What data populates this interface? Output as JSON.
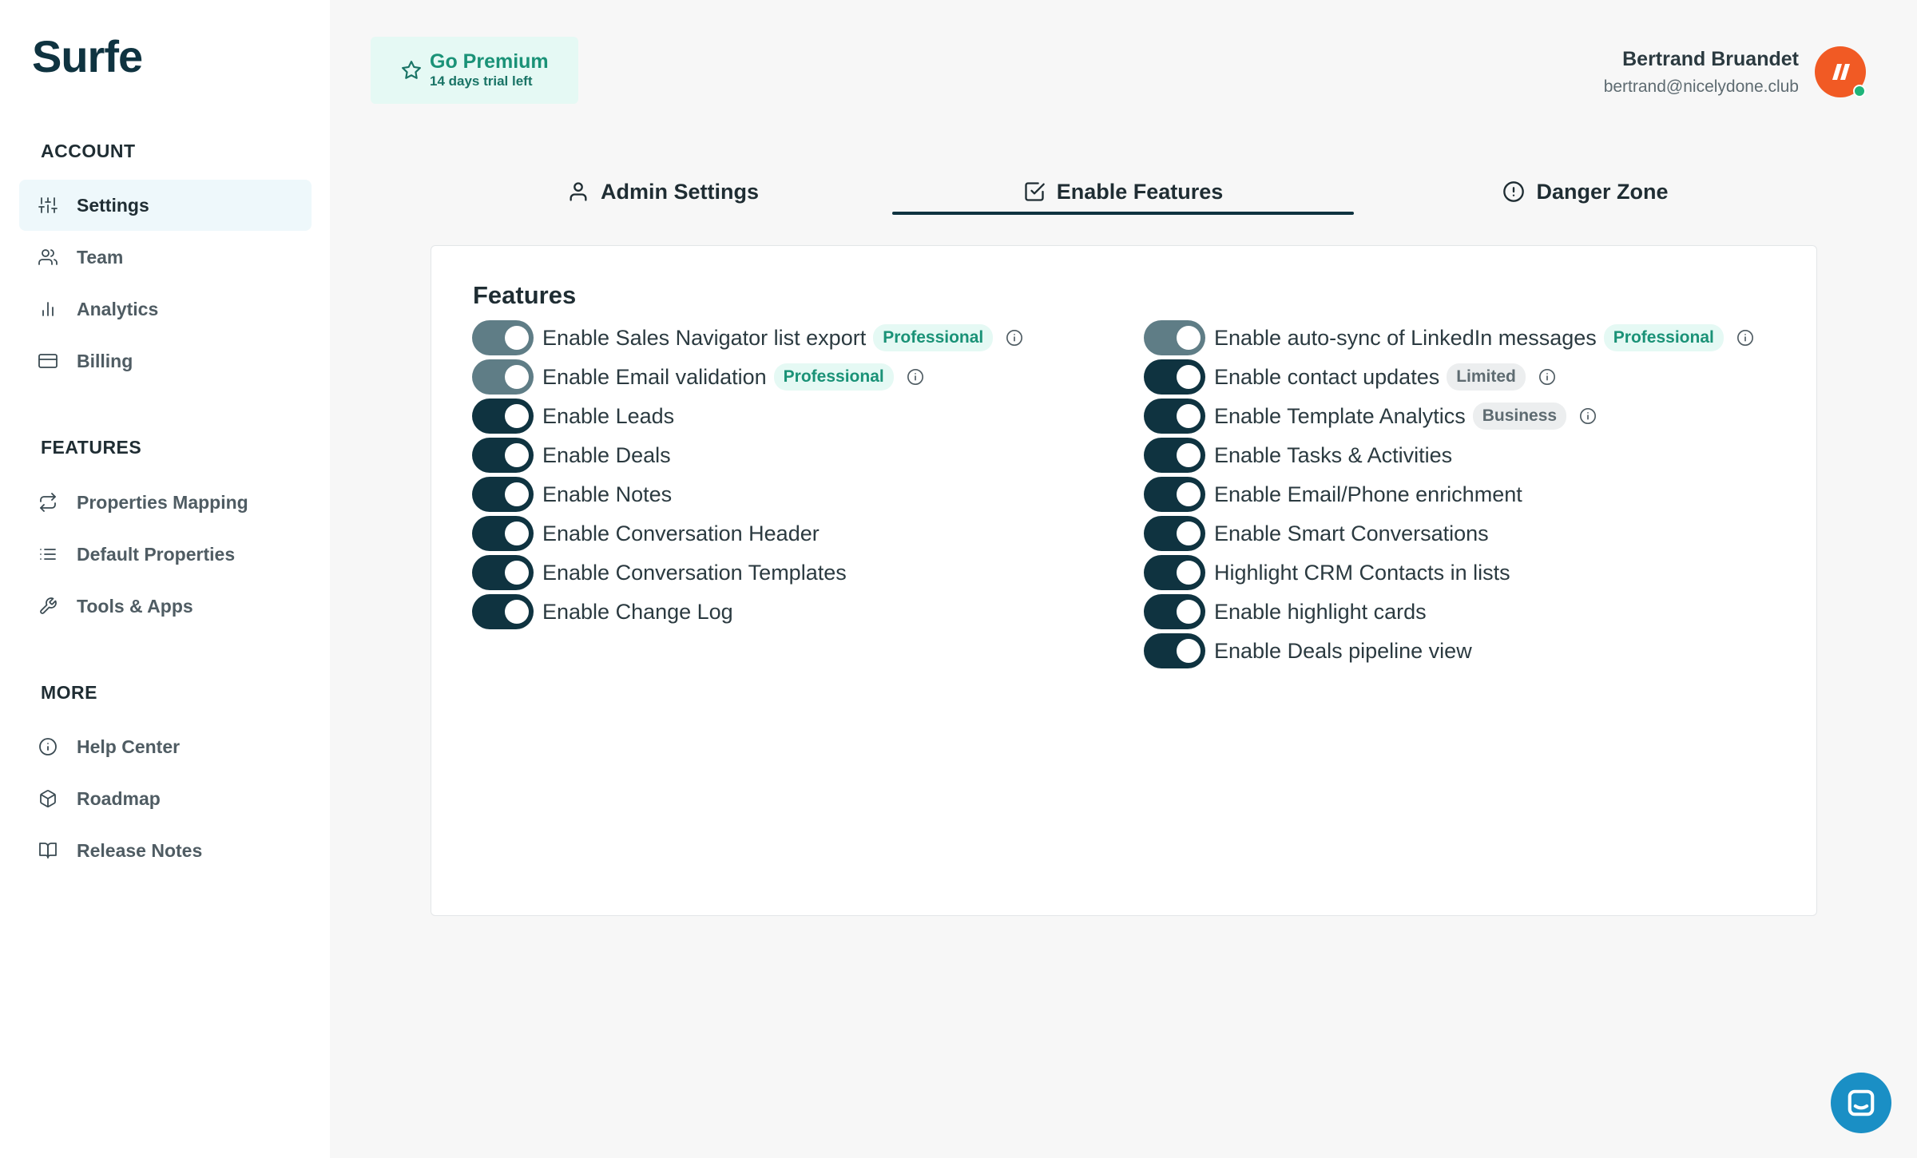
{
  "sidebar": {
    "logo": "Surfe",
    "sections": [
      {
        "title": "ACCOUNT",
        "items": [
          {
            "label": "Settings",
            "icon": "sliders-icon",
            "active": true
          },
          {
            "label": "Team",
            "icon": "users-icon"
          },
          {
            "label": "Analytics",
            "icon": "bar-chart-icon"
          },
          {
            "label": "Billing",
            "icon": "credit-card-icon"
          }
        ]
      },
      {
        "title": "FEATURES",
        "items": [
          {
            "label": "Properties Mapping",
            "icon": "repeat-icon"
          },
          {
            "label": "Default Properties",
            "icon": "list-icon"
          },
          {
            "label": "Tools & Apps",
            "icon": "tool-icon"
          }
        ]
      },
      {
        "title": "MORE",
        "items": [
          {
            "label": "Help Center",
            "icon": "info-icon"
          },
          {
            "label": "Roadmap",
            "icon": "box-icon"
          },
          {
            "label": "Release Notes",
            "icon": "book-icon"
          }
        ]
      }
    ]
  },
  "header": {
    "premium_title": "Go Premium",
    "premium_subtitle": "14 days trial left",
    "user_name": "Bertrand Bruandet",
    "user_email": "bertrand@nicelydone.club"
  },
  "tabs": [
    {
      "label": "Admin Settings",
      "icon": "user-icon"
    },
    {
      "label": "Enable Features",
      "icon": "check-square-icon",
      "active": true
    },
    {
      "label": "Danger Zone",
      "icon": "alert-circle-icon"
    }
  ],
  "card": {
    "title": "Features",
    "left_features": [
      {
        "label": "Enable Sales Navigator list export",
        "badge": "Professional",
        "badge_style": "pro",
        "info": true,
        "dim": true
      },
      {
        "label": "Enable Email validation",
        "badge": "Professional",
        "badge_style": "pro",
        "info": true,
        "dim": true
      },
      {
        "label": "Enable Leads"
      },
      {
        "label": "Enable Deals"
      },
      {
        "label": "Enable Notes"
      },
      {
        "label": "Enable Conversation Header"
      },
      {
        "label": "Enable Conversation Templates"
      },
      {
        "label": "Enable Change Log"
      }
    ],
    "right_features": [
      {
        "label": "Enable auto-sync of LinkedIn messages",
        "badge": "Professional",
        "badge_style": "pro",
        "info": true,
        "dim": true
      },
      {
        "label": "Enable contact updates",
        "badge": "Limited",
        "badge_style": "gray",
        "info": true
      },
      {
        "label": "Enable Template Analytics",
        "badge": "Business",
        "badge_style": "gray",
        "info": true
      },
      {
        "label": "Enable Tasks & Activities"
      },
      {
        "label": "Enable Email/Phone enrichment"
      },
      {
        "label": "Enable Smart Conversations"
      },
      {
        "label": "Highlight CRM Contacts in lists"
      },
      {
        "label": "Enable highlight cards"
      },
      {
        "label": "Enable Deals pipeline view"
      }
    ]
  },
  "colors": {
    "primary": "#0f3340",
    "toggle_dim": "#5f7d86",
    "premium_bg": "#e5f9f4",
    "premium_text": "#1a9277",
    "avatar": "#f15a24",
    "chat": "#1a8fc5"
  }
}
